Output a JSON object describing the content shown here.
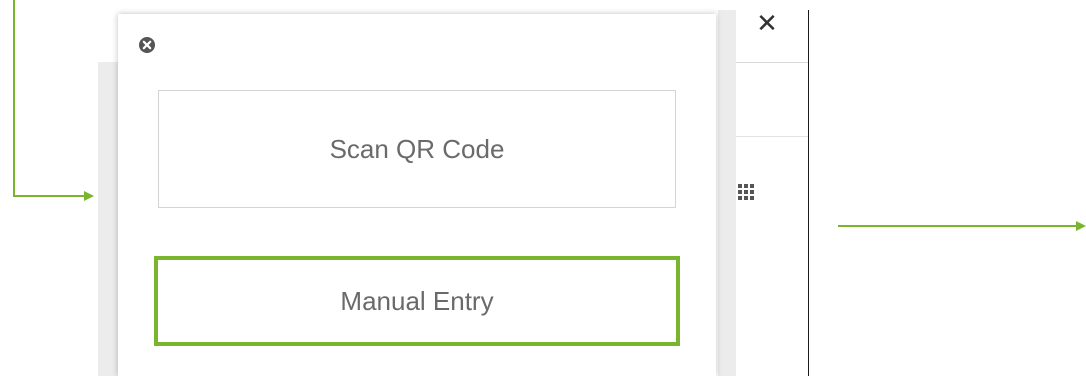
{
  "popup": {
    "scan_label": "Scan QR Code",
    "manual_label": "Manual Entry"
  },
  "background": {
    "close_glyph": "✕"
  },
  "icons": {
    "popup_close": "close-circle-icon",
    "background_close": "close-icon",
    "grid": "grid-icon"
  },
  "colors": {
    "annotation_green": "#7ab52e",
    "button_text": "#6a6a6a",
    "button_border": "#d4d4d4"
  }
}
